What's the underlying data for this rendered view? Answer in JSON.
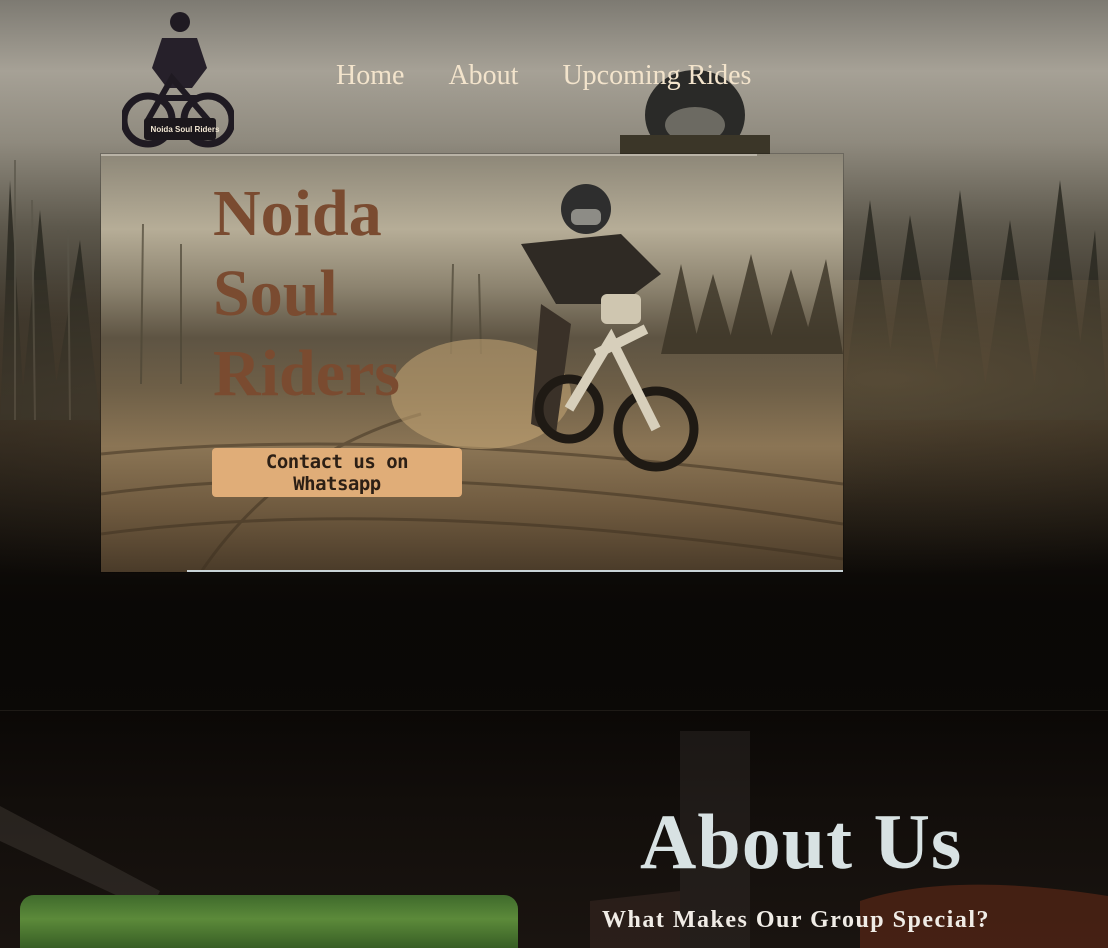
{
  "brand": {
    "logo_text": "Noida Soul Riders"
  },
  "nav": {
    "items": [
      {
        "label": "Home"
      },
      {
        "label": "About"
      },
      {
        "label": "Upcoming Rides"
      }
    ]
  },
  "hero": {
    "title_lines": [
      "Noida",
      "Soul",
      "Riders"
    ],
    "cta_label": "Contact us on Whatsapp"
  },
  "about": {
    "title": "About Us",
    "subtitle": "What Makes Our Group Special?"
  },
  "colors": {
    "nav_text": "#f3e4cc",
    "hero_title": "#7a4b30",
    "cta_bg": "#e0ad78",
    "about_title": "#d8e2e3"
  }
}
